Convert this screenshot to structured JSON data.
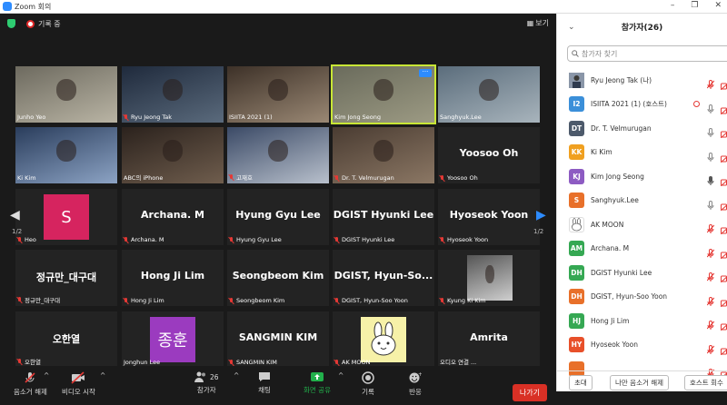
{
  "window": {
    "title": "Zoom 회의",
    "minimize": "–",
    "restore": "❐",
    "close": "✕"
  },
  "topbar": {
    "recording": "기록 중",
    "view": "보기"
  },
  "tiles": [
    {
      "name": "Junho Yeo",
      "muted": false,
      "type": "video",
      "c1": "#6d6a5f",
      "c2": "#b9b4a4"
    },
    {
      "name": "Ryu Jeong Tak",
      "muted": true,
      "type": "video",
      "c1": "#1f2a3c",
      "c2": "#5a6a7c"
    },
    {
      "name": "ISIITA 2021 (1)",
      "muted": false,
      "type": "video",
      "c1": "#3d3128",
      "c2": "#9a8874"
    },
    {
      "name": "Kim Jong Seong",
      "muted": false,
      "type": "video",
      "c1": "#6a6b5c",
      "c2": "#9c9a83",
      "active": true
    },
    {
      "name": "Sanghyuk.Lee",
      "muted": false,
      "type": "video",
      "c1": "#5b6d7c",
      "c2": "#a8b4bc"
    },
    {
      "name": "Ki Kim",
      "muted": false,
      "type": "video",
      "c1": "#2a3d5c",
      "c2": "#8ca3c4"
    },
    {
      "name": "ABC의 iPhone",
      "muted": false,
      "type": "video",
      "c1": "#2b221d",
      "c2": "#6f5d4d"
    },
    {
      "name": "고재호",
      "muted": true,
      "type": "video",
      "c1": "#3b4a66",
      "c2": "#b8c0cc"
    },
    {
      "name": "Dr. T. Velmurugan",
      "muted": true,
      "type": "video",
      "c1": "#4a3c32",
      "c2": "#8b7764"
    },
    {
      "name": "Yoosoo Oh",
      "muted": true,
      "type": "name",
      "big": "Yoosoo Oh"
    },
    {
      "name": "Heo",
      "muted": true,
      "type": "avatar",
      "initial": "S",
      "avcolor": "#d6245f"
    },
    {
      "name": "Archana. M",
      "muted": true,
      "type": "name",
      "big": "Archana. M"
    },
    {
      "name": "Hyung Gyu Lee",
      "muted": true,
      "type": "name",
      "big": "Hyung Gyu Lee"
    },
    {
      "name": "DGIST Hyunki Lee",
      "muted": true,
      "type": "name",
      "big": "DGIST Hyunki Lee"
    },
    {
      "name": "Hyoseok Yoon",
      "muted": true,
      "type": "name",
      "big": "Hyoseok Yoon"
    },
    {
      "name": "정규만_대구대",
      "muted": true,
      "type": "name",
      "big": "정규만_대구대"
    },
    {
      "name": "Hong Ji Lim",
      "muted": true,
      "type": "name",
      "big": "Hong Ji Lim"
    },
    {
      "name": "Seongbeom Kim",
      "muted": true,
      "type": "name",
      "big": "Seongbeom Kim"
    },
    {
      "name": "DGIST, Hyun-Soo Yoon",
      "muted": true,
      "type": "name",
      "big": "DGIST, Hyun-So..."
    },
    {
      "name": "Kyung Ki Kim",
      "muted": true,
      "type": "photo",
      "c1": "#555555",
      "c2": "#cfcfcf"
    },
    {
      "name": "오한열",
      "muted": true,
      "type": "name",
      "big": "오한열"
    },
    {
      "name": "Jonghun Lee",
      "muted": false,
      "type": "avatar",
      "initial": "종훈",
      "avcolor": "#9b3bbf"
    },
    {
      "name": "SANGMIN KIM",
      "muted": true,
      "type": "name",
      "big": "SANGMIN KIM"
    },
    {
      "name": "AK MOON",
      "muted": true,
      "type": "bunny"
    },
    {
      "name": "오디오 연결 ...",
      "muted": false,
      "type": "name",
      "big": "Amrita"
    }
  ],
  "pager": {
    "left": "1/2",
    "right": "1/2"
  },
  "toolbar": {
    "mute": "음소거 해제",
    "video": "비디오 시작",
    "participants": "참가자",
    "participants_count": "26",
    "chat": "채팅",
    "share": "화면 공유",
    "record": "기록",
    "reactions": "반응",
    "leave": "나가기"
  },
  "sidebar": {
    "title": "참가자(26)",
    "search_placeholder": "참가자 찾기",
    "participants": [
      {
        "initials": "",
        "name": "Ryu Jeong Tak (나)",
        "color": "#7a8aa0",
        "mic": "off",
        "photo": true
      },
      {
        "initials": "I2",
        "name": "ISIITA 2021 (1) (호스트)",
        "color": "#3b8fd9",
        "mic": "on",
        "rec": true
      },
      {
        "initials": "DT",
        "name": "Dr. T. Velmurugan",
        "color": "#4d5a6b",
        "mic": "on"
      },
      {
        "initials": "KK",
        "name": "Ki Kim",
        "color": "#f0a020",
        "mic": "on"
      },
      {
        "initials": "KJ",
        "name": "Kim Jong Seong",
        "color": "#8d5bc2",
        "mic": "active"
      },
      {
        "initials": "S",
        "name": "Sanghyuk.Lee",
        "color": "#e8702a",
        "mic": "on"
      },
      {
        "initials": "",
        "name": "AK MOON",
        "color": "#ffffff",
        "mic": "off",
        "bunny": true
      },
      {
        "initials": "AM",
        "name": "Archana. M",
        "color": "#35a853",
        "mic": "off"
      },
      {
        "initials": "DH",
        "name": "DGIST Hyunki Lee",
        "color": "#35a853",
        "mic": "off"
      },
      {
        "initials": "DH",
        "name": "DGIST, Hyun-Soo Yoon",
        "color": "#e8702a",
        "mic": "off"
      },
      {
        "initials": "HJ",
        "name": "Hong Ji Lim",
        "color": "#35a853",
        "mic": "off"
      },
      {
        "initials": "HY",
        "name": "Hyoseok Yoon",
        "color": "#e8502a",
        "mic": "off"
      },
      {
        "initials": "",
        "name": "",
        "color": "#e8702a",
        "mic": "off"
      }
    ],
    "invite": "초대",
    "mute_me": "나만 음소거 해제",
    "host_reclaim": "호스트 회수"
  }
}
